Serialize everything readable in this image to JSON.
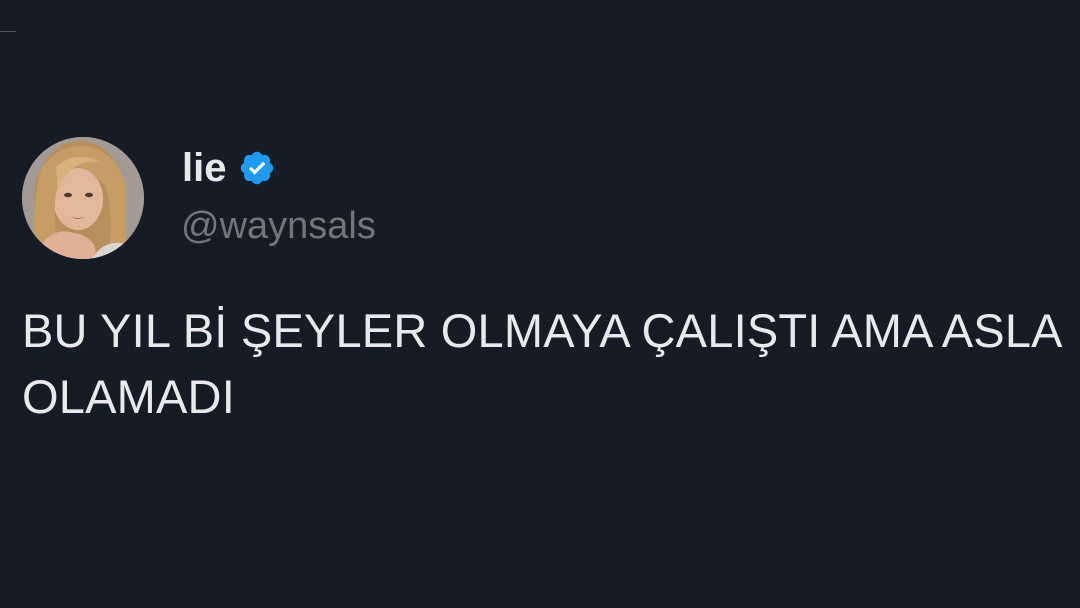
{
  "tweet": {
    "author": {
      "display_name": "lie",
      "handle": "@waynsals",
      "verified": true,
      "avatar": "profile-photo"
    },
    "text": "BU YIL Bİ ŞEYLER OLMAYA ÇALIŞTI AMA ASLA OLAMADI"
  },
  "colors": {
    "background": "#151c26",
    "text_primary": "#e7e9ea",
    "text_secondary": "#71767b",
    "verified_badge": "#1d9bf0"
  },
  "icons": {
    "verified": "verified-badge-icon"
  }
}
